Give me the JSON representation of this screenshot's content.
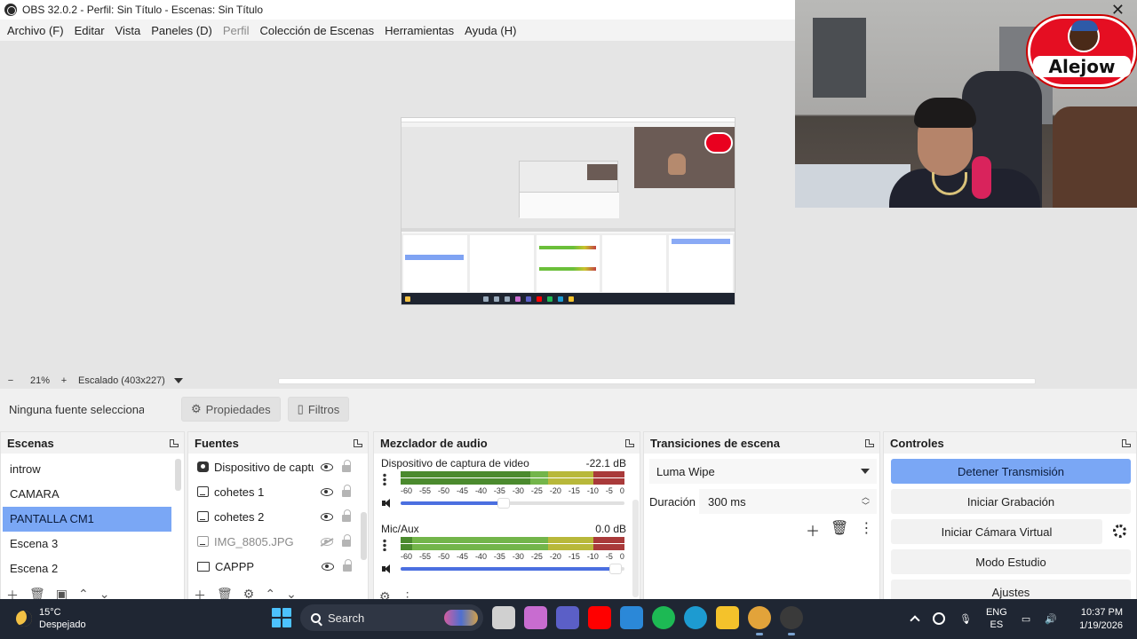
{
  "window": {
    "title": "OBS 32.0.2 - Perfil: Sin Título - Escenas: Sin Título"
  },
  "menu": [
    {
      "label": "Archivo (F)",
      "enabled": true
    },
    {
      "label": "Editar",
      "enabled": true
    },
    {
      "label": "Vista",
      "enabled": true
    },
    {
      "label": "Paneles (D)",
      "enabled": true
    },
    {
      "label": "Perfil",
      "enabled": false
    },
    {
      "label": "Colección de Escenas",
      "enabled": true
    },
    {
      "label": "Herramientas",
      "enabled": true
    },
    {
      "label": "Ayuda (H)",
      "enabled": true
    }
  ],
  "webcam": {
    "logo_text": "Alejow",
    "close_glyph": "✕"
  },
  "zoom": {
    "minus": "−",
    "value": "21%",
    "plus": "+",
    "mode": "Escalado (403x227)"
  },
  "source_bar": {
    "no_selection": "Ninguna fuente seleccionada",
    "properties_label": "Propiedades",
    "filters_label": "Filtros"
  },
  "scenes": {
    "title": "Escenas",
    "items": [
      "introw",
      "CAMARA",
      "PANTALLA CM1",
      "Escena 3",
      "Escena 2"
    ],
    "selected_index": 2
  },
  "sources": {
    "title": "Fuentes",
    "items": [
      {
        "name": "Dispositivo de captura de video",
        "icon": "camera-icon",
        "visible": true
      },
      {
        "name": "cohetes 1",
        "icon": "image-icon",
        "visible": true
      },
      {
        "name": "cohetes 2",
        "icon": "image-icon",
        "visible": true
      },
      {
        "name": "IMG_8805.JPG",
        "icon": "image-icon",
        "visible": false
      },
      {
        "name": "CAPPP",
        "icon": "monitor-icon",
        "visible": true
      }
    ]
  },
  "mixer": {
    "title": "Mezclador de audio",
    "scale": [
      "-60",
      "-55",
      "-50",
      "-45",
      "-40",
      "-35",
      "-30",
      "-25",
      "-20",
      "-15",
      "-10",
      "-5",
      "0"
    ],
    "channels": [
      {
        "name": "Dispositivo de captura de video",
        "level": "-22.1 dB",
        "meter_fraction": 0.58,
        "volume_fraction": 0.46
      },
      {
        "name": "Mic/Aux",
        "level": "0.0 dB",
        "meter_fraction": 0.05,
        "volume_fraction": 0.96
      }
    ]
  },
  "transitions": {
    "title": "Transiciones de escena",
    "selected": "Luma Wipe",
    "duration_label": "Duración",
    "duration_value": "300 ms"
  },
  "controls": {
    "title": "Controles",
    "buttons": [
      {
        "label": "Detener Transmisión",
        "active": true
      },
      {
        "label": "Iniciar Grabación",
        "active": false
      },
      {
        "label": "Iniciar Cámara Virtual",
        "active": false
      },
      {
        "label": "Modo Estudio",
        "active": false
      },
      {
        "label": "Ajustes",
        "active": false
      }
    ]
  },
  "taskbar": {
    "weather_temp": "15°C",
    "weather_desc": "Despejado",
    "search_placeholder": "Search",
    "lang_top": "ENG",
    "lang_bottom": "ES",
    "time": "10:37 PM",
    "date": "1/19/2026",
    "apps": [
      {
        "name": "task-view-icon",
        "color": "#d0d0d0"
      },
      {
        "name": "copilot-icon",
        "color": "#c86cd0"
      },
      {
        "name": "teams-icon",
        "color": "#5b5fc7"
      },
      {
        "name": "youtube-icon",
        "color": "#ff0000"
      },
      {
        "name": "store-icon",
        "color": "#2b88d8"
      },
      {
        "name": "spotify-icon",
        "color": "#1db954"
      },
      {
        "name": "edge-icon",
        "color": "#1d9bd1"
      },
      {
        "name": "explorer-icon",
        "color": "#f4c22b"
      },
      {
        "name": "chrome-icon",
        "color": "#e2a33a"
      },
      {
        "name": "obs-icon",
        "color": "#3a3a3a"
      }
    ]
  }
}
